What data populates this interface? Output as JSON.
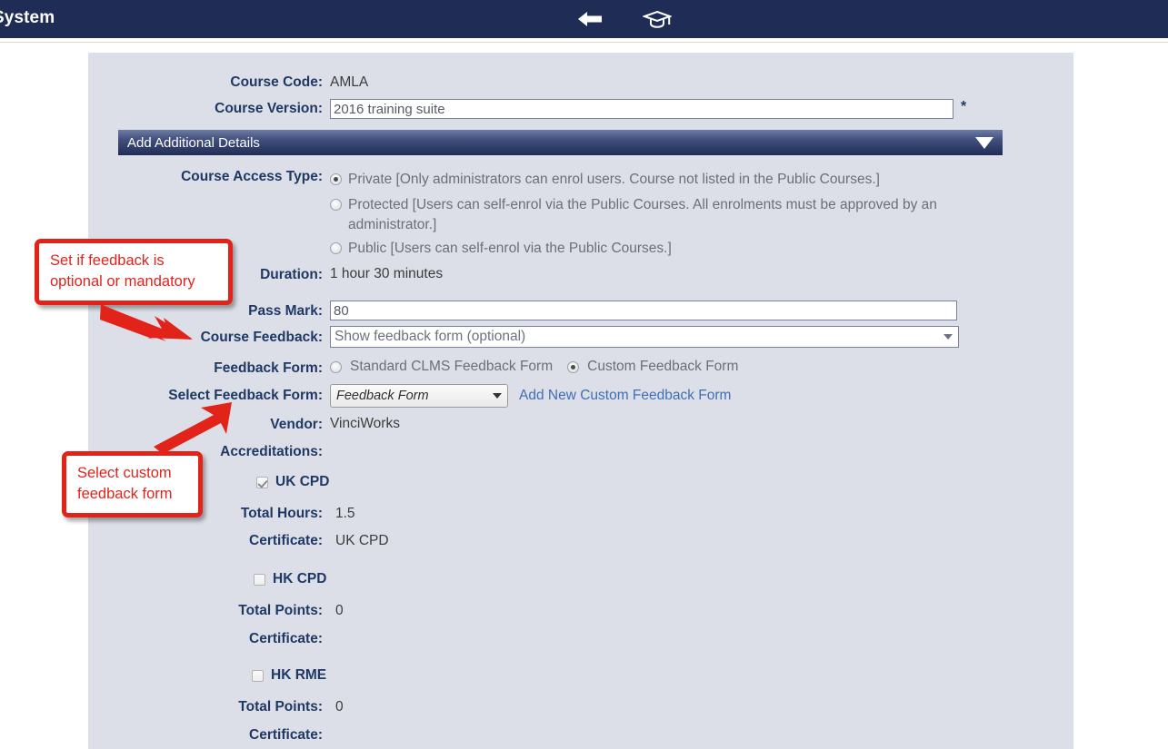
{
  "appbar": {
    "title": "System",
    "back_icon": "back-arrow-icon",
    "graduation_icon": "graduation-cap-icon"
  },
  "form": {
    "course_code": {
      "label": "Course Code:",
      "value": "AMLA"
    },
    "course_version": {
      "label": "Course Version:",
      "value": "2016 training suite",
      "required_marker": "*"
    },
    "section_header": {
      "title": "Add Additional Details",
      "caret": "chevron-down-icon"
    },
    "course_access_type": {
      "label": "Course Access Type:",
      "options": [
        {
          "text": "Private [Only administrators can enrol users. Course not listed in the Public Courses.]",
          "selected": true
        },
        {
          "text": "Protected [Users can self-enrol via the Public Courses. All enrolments must be approved by an administrator.]",
          "selected": false
        },
        {
          "text": "Public [Users can self-enrol via the Public Courses.]",
          "selected": false
        }
      ]
    },
    "duration": {
      "label": "Duration:",
      "value": "1 hour 30 minutes"
    },
    "pass_mark": {
      "label": "Pass Mark:",
      "value": "80"
    },
    "course_feedback": {
      "label": "Course Feedback:",
      "value": "Show feedback form (optional)"
    },
    "feedback_form": {
      "label": "Feedback Form:",
      "options": [
        {
          "text": "Standard CLMS Feedback Form",
          "selected": false
        },
        {
          "text": "Custom Feedback Form",
          "selected": true
        }
      ]
    },
    "select_feedback_form": {
      "label": "Select Feedback Form:",
      "value": "Feedback Form",
      "add_link": "Add New Custom Feedback Form"
    },
    "vendor": {
      "label": "Vendor:",
      "value": "VinciWorks"
    },
    "accreditations_label": "Accreditations:",
    "accreditations": [
      {
        "name": "UK CPD",
        "checked": true,
        "total_label": "Total Hours:",
        "total_value": "1.5",
        "certificate_label": "Certificate:",
        "certificate_value": "UK CPD"
      },
      {
        "name": "HK CPD",
        "checked": false,
        "total_label": "Total Points:",
        "total_value": "0",
        "certificate_label": "Certificate:",
        "certificate_value": ""
      },
      {
        "name": "HK RME",
        "checked": false,
        "total_label": "Total Points:",
        "total_value": "0",
        "certificate_label": "Certificate:",
        "certificate_value": ""
      }
    ]
  },
  "annotations": [
    {
      "text": "Set if feedback is optional or mandatory"
    },
    {
      "text": "Select custom feedback form"
    }
  ],
  "colors": {
    "appbar": "#1f2d56",
    "panel": "#dcdfe8",
    "label": "#1f3864",
    "annotation": "#e2231a",
    "link": "#3f6fb5"
  }
}
